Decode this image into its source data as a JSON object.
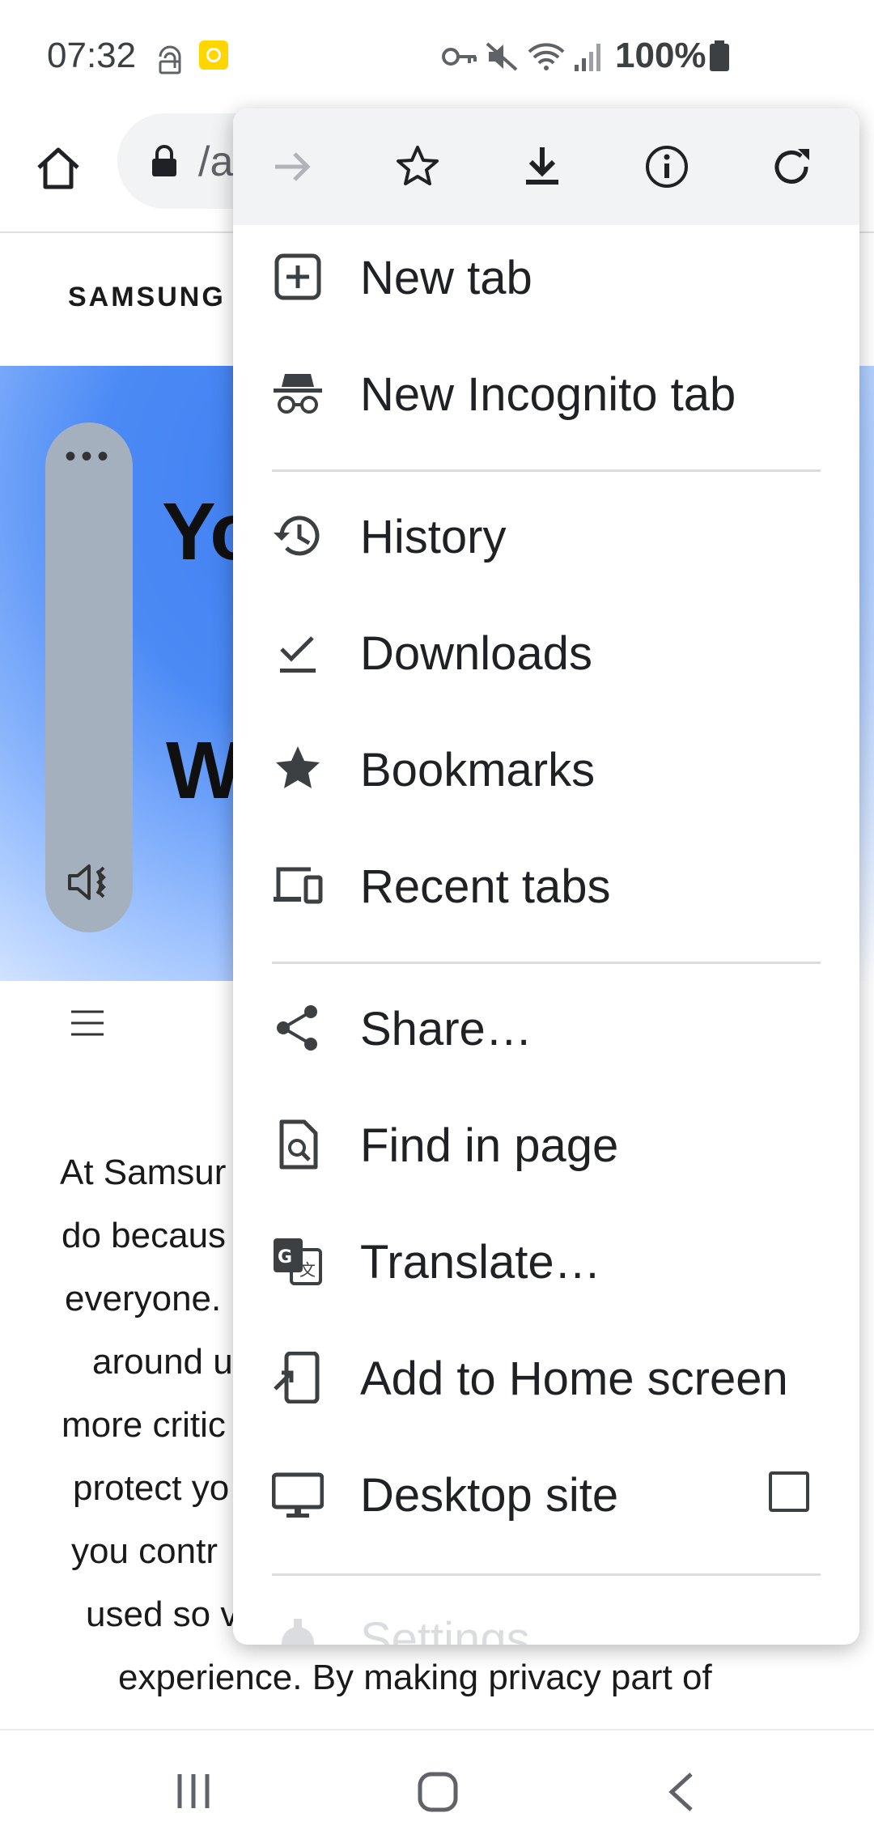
{
  "status_bar": {
    "time": "07:32",
    "battery": "100%"
  },
  "toolbar": {
    "url_fragment": "/a"
  },
  "page": {
    "brand": "SAMSUNG P",
    "hero_line1": "Yo",
    "hero_line2": "W",
    "handle_dots": "•••",
    "body_lines": [
      "At Samsur",
      "do becaus",
      "everyone.",
      "around u",
      "more critic",
      "protect yo",
      "you contr",
      "used so v",
      "experience. By making privacy part of"
    ]
  },
  "menu": {
    "items": [
      {
        "label": "New tab",
        "icon": "add-box-icon"
      },
      {
        "label": "New Incognito tab",
        "icon": "incognito-icon"
      },
      {
        "label": "History",
        "icon": "history-icon"
      },
      {
        "label": "Downloads",
        "icon": "download-done-icon"
      },
      {
        "label": "Bookmarks",
        "icon": "star-filled-icon"
      },
      {
        "label": "Recent tabs",
        "icon": "devices-icon"
      },
      {
        "label": "Share…",
        "icon": "share-icon"
      },
      {
        "label": "Find in page",
        "icon": "find-in-page-icon"
      },
      {
        "label": "Translate…",
        "icon": "translate-icon"
      },
      {
        "label": "Add to Home screen",
        "icon": "add-to-home-icon"
      },
      {
        "label": "Desktop site",
        "icon": "desktop-icon"
      },
      {
        "label": "Settings",
        "icon": "gear-icon"
      }
    ]
  },
  "colors": {
    "menu_header_bg": "#f1f3f4",
    "hero_blue": "#4b8af5",
    "text_primary": "#202124"
  }
}
